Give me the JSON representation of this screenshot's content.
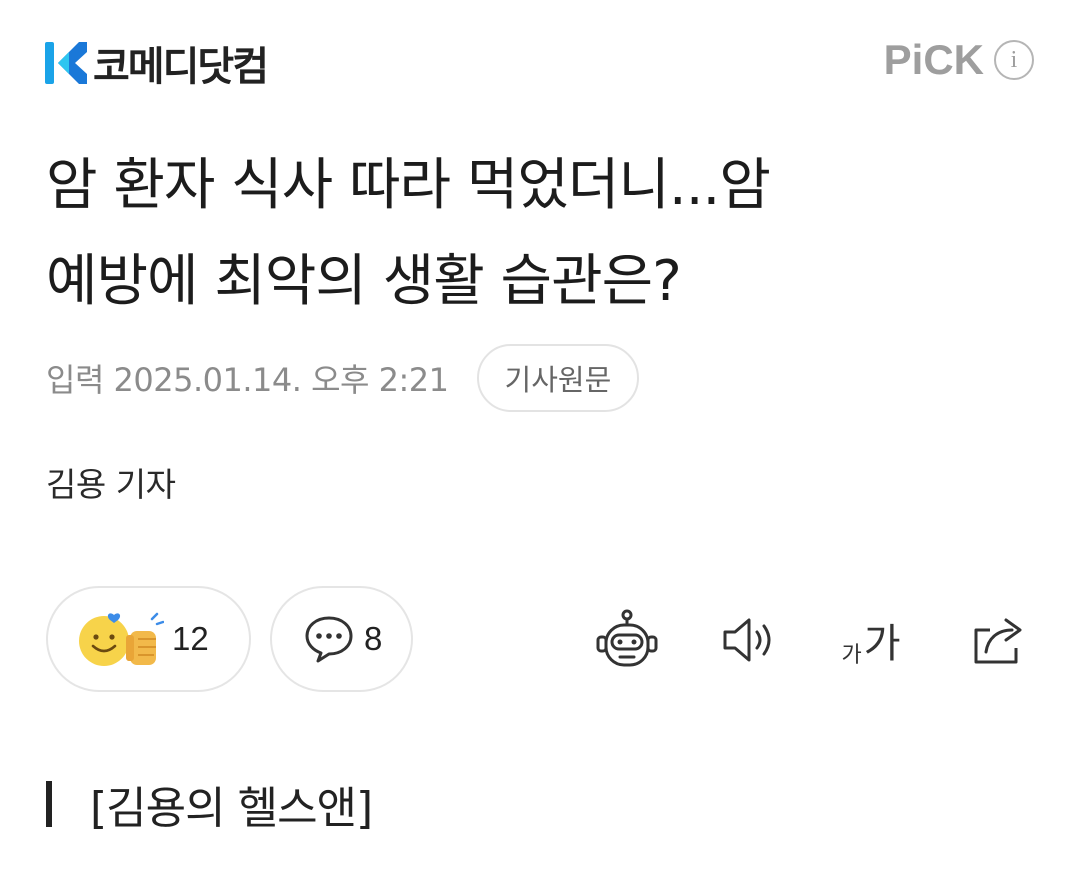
{
  "header": {
    "brand": "코메디닷컴",
    "pick_label": "PiCK",
    "info_label": "i"
  },
  "article": {
    "title_line1": "암 환자 식사 따라 먹었더니...암",
    "title_line2": "예방에 최악의 생활 습관은?",
    "date": "입력 2025.01.14. 오후 2:21",
    "original_label": "기사원문",
    "reporter": "김용 기자",
    "section": "[김용의 헬스앤]"
  },
  "reactions": {
    "like_count": "12",
    "comment_count": "8"
  },
  "tools": {
    "font_small": "가",
    "font_large": "가"
  },
  "colors": {
    "brand_blue": "#1f8fe0",
    "muted": "#8b8b8b",
    "border": "#e3e3e3",
    "emoji_yellow": "#f7d34a"
  }
}
